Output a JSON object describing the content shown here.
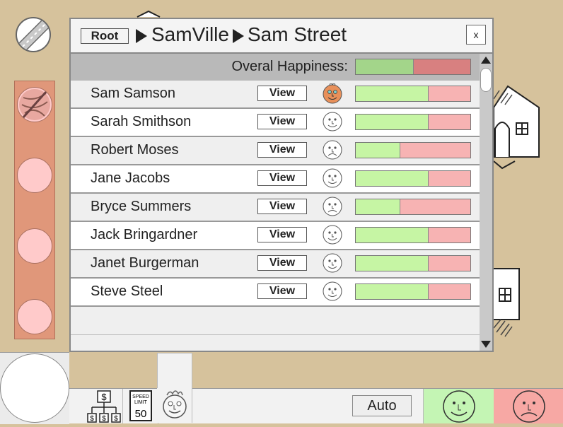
{
  "breadcrumb": {
    "root_label": "Root",
    "level1": "SamVille",
    "level2": "Sam Street"
  },
  "dialog": {
    "close_label": "x",
    "overall_label": "Overal Happiness:",
    "overall_happiness": 0.5
  },
  "colors": {
    "happy_green": "#c6f5a4",
    "overall_green": "#a3d58a",
    "unhappy_red": "#f7b3b3",
    "overall_red": "#d88080",
    "toolbar_orange": "#e0977a",
    "ground_tan": "#d6c29c"
  },
  "residents": [
    {
      "name": "Sam Samson",
      "view_label": "View",
      "happiness": 0.63,
      "face": "happy",
      "selected": true
    },
    {
      "name": "Sarah Smithson",
      "view_label": "View",
      "happiness": 0.63,
      "face": "happy",
      "selected": false
    },
    {
      "name": "Robert Moses",
      "view_label": "View",
      "happiness": 0.38,
      "face": "sad",
      "selected": false
    },
    {
      "name": "Jane Jacobs",
      "view_label": "View",
      "happiness": 0.63,
      "face": "happy",
      "selected": false
    },
    {
      "name": "Bryce Summers",
      "view_label": "View",
      "happiness": 0.38,
      "face": "sad",
      "selected": false
    },
    {
      "name": "Jack Bringardner",
      "view_label": "View",
      "happiness": 0.63,
      "face": "happy",
      "selected": false
    },
    {
      "name": "Janet Burgerman",
      "view_label": "View",
      "happiness": 0.63,
      "face": "happy",
      "selected": false
    },
    {
      "name": "Steve Steel",
      "view_label": "View",
      "happiness": 0.63,
      "face": "happy",
      "selected": false
    }
  ],
  "bottom_toolbar": {
    "speed_sign": {
      "line1": "SPEED",
      "line2": "LIMIT",
      "value": "50"
    },
    "money_symbol": "$",
    "auto_label": "Auto"
  },
  "icons": {
    "road": "road-icon",
    "money_tree": "money-tree-icon",
    "speed_limit": "speed-limit-sign-icon",
    "person": "person-face-icon",
    "happy": "happy-face-icon",
    "sad": "sad-face-icon"
  }
}
